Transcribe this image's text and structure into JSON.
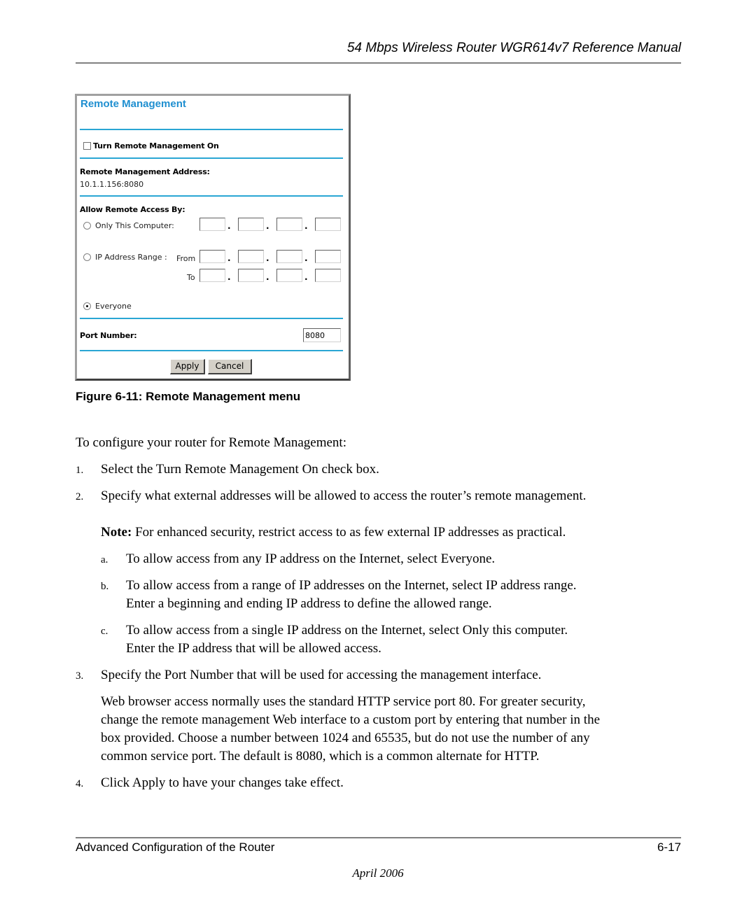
{
  "header": {
    "running_title": "54 Mbps Wireless Router WGR614v7 Reference Manual"
  },
  "router_ui": {
    "title": "Remote Management",
    "turn_on_checkbox": {
      "label": "Turn Remote Management On",
      "checked": false
    },
    "address_label": "Remote Management Address:",
    "address_value": "10.1.1.156:8080",
    "allow_access_label": "Allow Remote Access By:",
    "options": {
      "only_this_computer": {
        "label": "Only This Computer:",
        "selected": false
      },
      "ip_range": {
        "label": "IP Address Range :",
        "from_label": "From",
        "to_label": "To",
        "selected": false
      },
      "everyone": {
        "label": "Everyone",
        "selected": true
      }
    },
    "ip_separator": ".",
    "port_label": "Port Number:",
    "port_value": "8080",
    "apply_label": "Apply",
    "cancel_label": "Cancel",
    "accent_color": "#2aa6d4",
    "title_color": "#1f8fd0"
  },
  "figure": {
    "caption": "Figure 6-11:  Remote Management menu"
  },
  "body": {
    "intro": "To configure your router for Remote Management:",
    "steps": [
      {
        "num": "1.",
        "text": "Select the Turn Remote Management On check box."
      },
      {
        "num": "2.",
        "text": "Specify what external addresses will be allowed to access the router’s remote management."
      },
      {
        "num": "3.",
        "text": "Specify the Port Number that will be used for accessing the management interface."
      },
      {
        "num": "4.",
        "text": "Click Apply to have your changes take effect."
      }
    ],
    "note_label": "Note:",
    "note_text": " For enhanced security, restrict access to as few external IP addresses as practical.",
    "substeps": [
      {
        "num": "a.",
        "lines": [
          "To allow access from any IP address on the Internet, select Everyone."
        ]
      },
      {
        "num": "b.",
        "lines": [
          "To allow access from a range of IP addresses on the Internet, select IP address range.",
          "Enter a beginning and ending IP address to define the allowed range."
        ]
      },
      {
        "num": "c.",
        "lines": [
          "To allow access from a single IP address on the Internet, select Only this computer.",
          "Enter the IP address that will be allowed access."
        ]
      }
    ],
    "port_paragraph": [
      "Web browser access normally uses the standard HTTP service port 80. For greater security,",
      "change the remote management Web interface to a custom port by entering that number in the",
      "box provided. Choose a number between 1024 and 65535, but do not use the number of any",
      "common service port. The default is 8080, which is a common alternate for HTTP."
    ]
  },
  "footer": {
    "section": "Advanced Configuration of the Router",
    "page": "6-17",
    "date": "April 2006"
  }
}
